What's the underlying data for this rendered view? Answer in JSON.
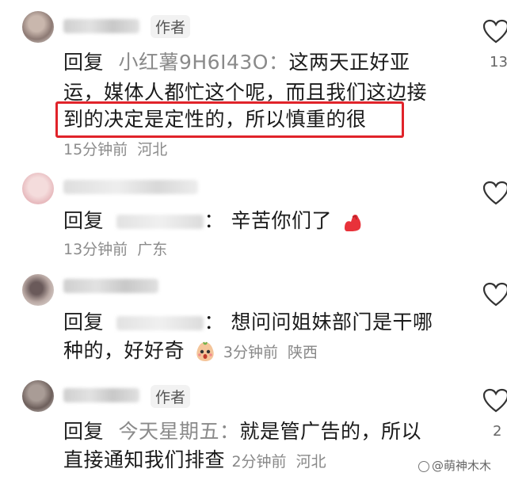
{
  "comments": [
    {
      "author_tag": "作者",
      "reply_label": "回复",
      "mention": "小红薯9H6I43O：",
      "text_lines": [
        "这两天正好亚",
        "运，媒体人都忙这个呢，而且我们这边接",
        "到的决定是定性的，所以慎重的很"
      ],
      "time": "15分钟前",
      "location": "河北",
      "likes": "13"
    },
    {
      "reply_label": "回复",
      "mention_suffix": "：",
      "text": "辛苦你们了",
      "emoji": "flexed-biceps",
      "time": "13分钟前",
      "location": "广东"
    },
    {
      "reply_label": "回复",
      "mention_suffix": "：",
      "text_line1": "想问问姐妹部门是干哪",
      "text_line2": "种的，好好奇",
      "emoji": "curious-face",
      "time": "3分钟前",
      "location": "陕西"
    },
    {
      "author_tag": "作者",
      "reply_label": "回复",
      "mention": "今天星期五：",
      "text_line1": "就是管广告的，所以",
      "text_line2": "直接通知我们排查",
      "time": "2分钟前",
      "location": "河北",
      "likes": "2"
    }
  ],
  "watermark": "@萌神木木",
  "colors": {
    "highlight": "#e0232a",
    "mention": "#8a8a8a",
    "meta": "#8b8b8b"
  }
}
